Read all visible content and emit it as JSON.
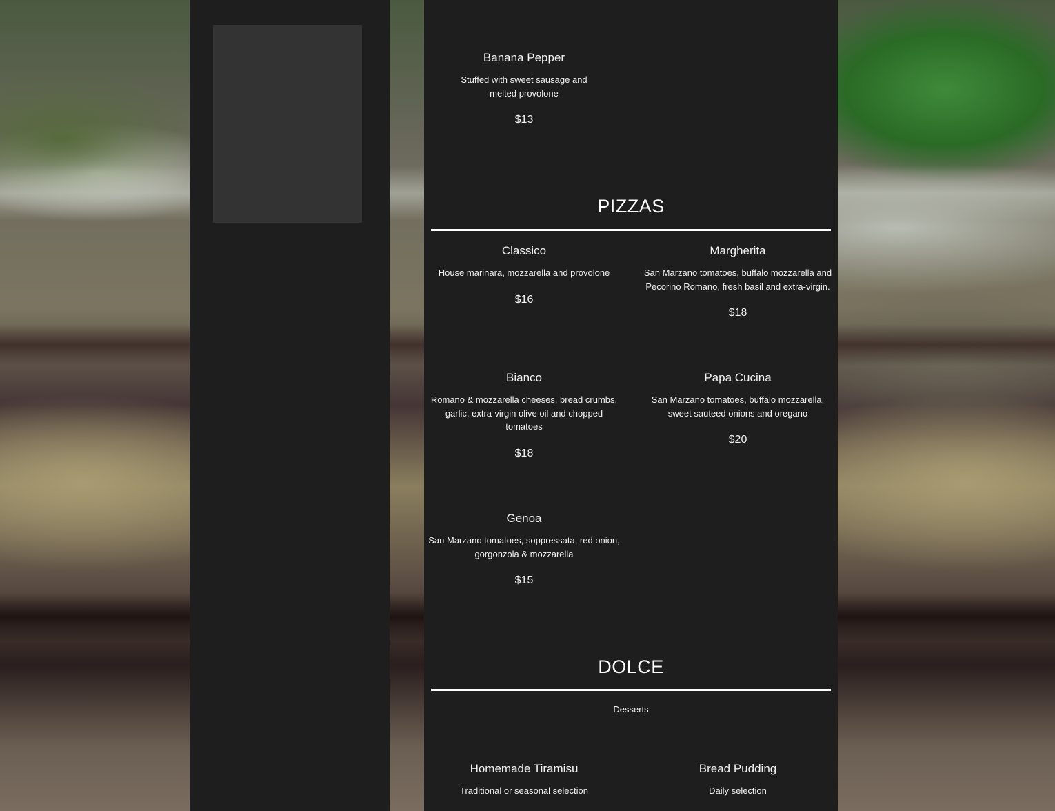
{
  "menu": {
    "top_item": {
      "name": "Banana Pepper",
      "description": "Stuffed with sweet sausage and melted provolone",
      "price": "$13"
    },
    "sections": [
      {
        "title": "PIZZAS",
        "subtitle": "",
        "items": [
          {
            "name": "Classico",
            "description": "House marinara, mozzarella and provolone",
            "price": "$16"
          },
          {
            "name": "Margherita",
            "description": "San Marzano tomatoes, buffalo mozzarella and Pecorino Romano, fresh basil and extra-virgin.",
            "price": "$18"
          },
          {
            "name": "Bianco",
            "description": "Romano & mozzarella cheeses, bread crumbs, garlic, extra-virgin olive oil and chopped tomatoes",
            "price": "$18"
          },
          {
            "name": "Papa Cucina",
            "description": "San Marzano tomatoes, buffalo mozzarella, sweet sauteed onions and oregano",
            "price": "$20"
          },
          {
            "name": "Genoa",
            "description": "San Marzano tomatoes, soppressata, red onion, gorgonzola & mozzarella",
            "price": "$15"
          }
        ]
      },
      {
        "title": "DOLCE",
        "subtitle": "Desserts",
        "items": [
          {
            "name": "Homemade Tiramisu",
            "description": "Traditional or seasonal selection"
          },
          {
            "name": "Bread Pudding",
            "description": "Daily selection"
          }
        ]
      }
    ]
  },
  "colors": {
    "panel": "#1e1e1e",
    "image_placeholder": "#333333",
    "text": "#ffffff"
  }
}
